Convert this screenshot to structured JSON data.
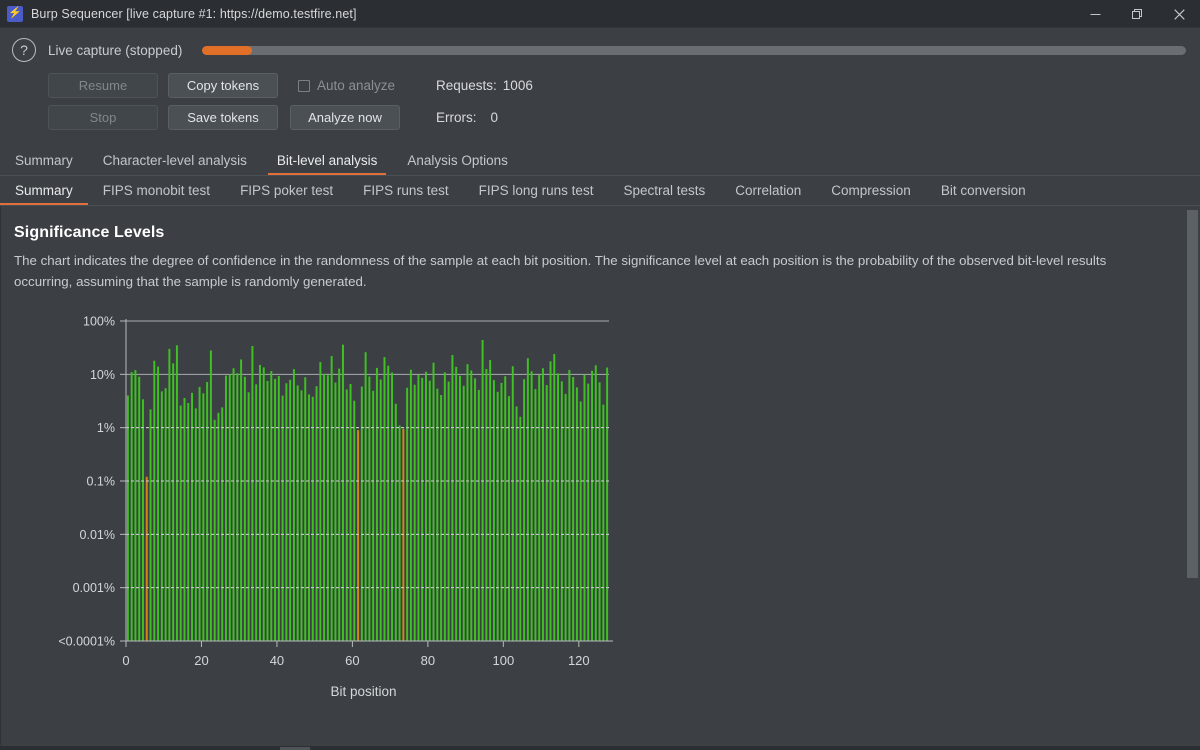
{
  "window": {
    "title": "Burp Sequencer [live capture #1: https://demo.testfire.net]",
    "app_icon": "burp-logo-icon",
    "controls": {
      "minimize": "minimize-icon",
      "restore": "restore-icon",
      "close": "close-icon"
    }
  },
  "toolbar": {
    "help_icon": "?",
    "capture_status": "Live capture (stopped)",
    "progress_percent": 5,
    "progress_color": "#e26f28",
    "buttons": {
      "resume": "Resume",
      "stop": "Stop",
      "copy_tokens": "Copy tokens",
      "save_tokens": "Save tokens",
      "analyze_now": "Analyze now"
    },
    "auto_analyze_label": "Auto analyze",
    "auto_analyze_checked": false,
    "requests_label": "Requests:",
    "requests_value": "1006",
    "errors_label": "Errors:",
    "errors_value": "0"
  },
  "main_tabs": [
    {
      "label": "Summary",
      "active": false
    },
    {
      "label": "Character-level analysis",
      "active": false
    },
    {
      "label": "Bit-level analysis",
      "active": true
    },
    {
      "label": "Analysis Options",
      "active": false
    }
  ],
  "sub_tabs": [
    {
      "label": "Summary",
      "active": true
    },
    {
      "label": "FIPS monobit test",
      "active": false
    },
    {
      "label": "FIPS poker test",
      "active": false
    },
    {
      "label": "FIPS runs test",
      "active": false
    },
    {
      "label": "FIPS long runs test",
      "active": false
    },
    {
      "label": "Spectral tests",
      "active": false
    },
    {
      "label": "Correlation",
      "active": false
    },
    {
      "label": "Compression",
      "active": false
    },
    {
      "label": "Bit conversion",
      "active": false
    }
  ],
  "panel": {
    "heading": "Significance Levels",
    "description": "The chart indicates the degree of confidence in the randomness of the sample at each bit position. The significance level at each position is the probability of the observed bit-level results occurring, assuming that the sample is randomly generated."
  },
  "chart_data": {
    "type": "bar",
    "title": "Significance Levels",
    "xlabel": "Bit position",
    "ylabel": "",
    "ytick_labels": [
      "100%",
      "10%",
      "1%",
      "0.1%",
      "0.01%",
      "0.001%",
      "<0.0001%"
    ],
    "ytick_values": [
      100,
      10,
      1,
      0.1,
      0.01,
      0.001,
      0.0001
    ],
    "xtick_labels": [
      "0",
      "20",
      "40",
      "60",
      "80",
      "100",
      "120"
    ],
    "xtick_values": [
      0,
      20,
      40,
      60,
      80,
      100,
      120
    ],
    "xlim": [
      0,
      128
    ],
    "ylim": [
      0.0001,
      100
    ],
    "yscale": "log",
    "grid": true,
    "legend": "none",
    "bar_color_high": "#3fc023",
    "bar_color_low": "#d08a12",
    "low_threshold_percent": 1,
    "x": [
      0,
      1,
      2,
      3,
      4,
      5,
      6,
      7,
      8,
      9,
      10,
      11,
      12,
      13,
      14,
      15,
      16,
      17,
      18,
      19,
      20,
      21,
      22,
      23,
      24,
      25,
      26,
      27,
      28,
      29,
      30,
      31,
      32,
      33,
      34,
      35,
      36,
      37,
      38,
      39,
      40,
      41,
      42,
      43,
      44,
      45,
      46,
      47,
      48,
      49,
      50,
      51,
      52,
      53,
      54,
      55,
      56,
      57,
      58,
      59,
      60,
      61,
      62,
      63,
      64,
      65,
      66,
      67,
      68,
      69,
      70,
      71,
      72,
      73,
      74,
      75,
      76,
      77,
      78,
      79,
      80,
      81,
      82,
      83,
      84,
      85,
      86,
      87,
      88,
      89,
      90,
      91,
      92,
      93,
      94,
      95,
      96,
      97,
      98,
      99,
      100,
      101,
      102,
      103,
      104,
      105,
      106,
      107,
      108,
      109,
      110,
      111,
      112,
      113,
      114,
      115,
      116,
      117,
      118,
      119,
      120,
      121,
      122,
      123,
      124,
      125,
      126,
      127
    ],
    "values": [
      4.0,
      11.0,
      12.0,
      9.0,
      3.4,
      0.12,
      2.2,
      18.0,
      14.0,
      4.8,
      5.5,
      30.0,
      16.0,
      35.0,
      2.6,
      3.6,
      2.9,
      4.5,
      2.3,
      5.8,
      4.4,
      7.2,
      28.0,
      1.4,
      1.9,
      2.4,
      9.5,
      10.0,
      13.0,
      10.5,
      19.0,
      9.0,
      4.6,
      34.0,
      6.5,
      15.0,
      13.5,
      7.5,
      11.5,
      8.2,
      9.3,
      4.0,
      6.8,
      7.9,
      12.5,
      6.2,
      5.0,
      8.8,
      4.2,
      3.8,
      6.0,
      17.0,
      10.2,
      9.6,
      22.0,
      7.0,
      12.8,
      36.0,
      5.2,
      6.6,
      3.2,
      0.9,
      5.9,
      26.0,
      9.1,
      4.9,
      13.2,
      8.0,
      21.0,
      14.5,
      10.8,
      2.8,
      1.1,
      0.95,
      5.6,
      12.2,
      6.4,
      9.8,
      8.6,
      11.2,
      7.6,
      16.5,
      5.4,
      4.1,
      10.9,
      7.3,
      23.0,
      13.8,
      9.4,
      6.1,
      15.5,
      11.8,
      8.4,
      5.1,
      44.0,
      12.6,
      18.5,
      7.8,
      4.7,
      6.9,
      9.2,
      3.9,
      14.2,
      2.5,
      1.6,
      8.1,
      20.0,
      11.4,
      5.3,
      9.7,
      13.0,
      6.3,
      17.5,
      24.0,
      10.4,
      7.4,
      4.3,
      12.1,
      8.9,
      5.7,
      3.1,
      9.9,
      6.7,
      11.6,
      14.8,
      7.1,
      2.7,
      13.4
    ]
  }
}
